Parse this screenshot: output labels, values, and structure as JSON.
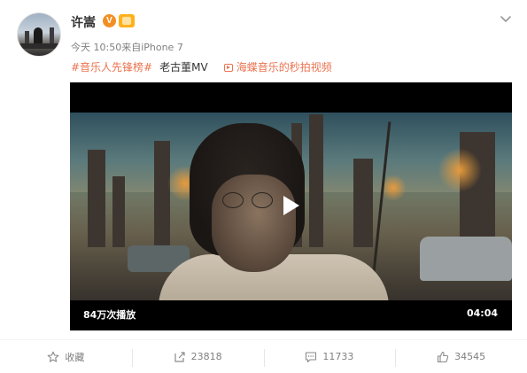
{
  "post": {
    "username": "许嵩",
    "badge_v": "V",
    "meta": "今天 10:50来自iPhone 7",
    "topic": "#音乐人先锋榜#",
    "text": "老古董MV",
    "video_link_label": "海蝶音乐的秒拍视频"
  },
  "video": {
    "view_count": "84万次播放",
    "duration": "04:04"
  },
  "actions": {
    "favorite_label": "收藏",
    "repost_count": "23818",
    "comment_count": "11733",
    "like_count": "34545"
  },
  "colors": {
    "accent": "#eb7350",
    "verified": "#f28f24",
    "vip": "#ffb11b",
    "video_bg": "#000000"
  },
  "icons": [
    "chevron-down-icon",
    "verified-v-icon",
    "vip-badge-icon",
    "video-link-icon",
    "play-icon",
    "star-icon",
    "repost-icon",
    "comment-icon",
    "like-icon"
  ]
}
